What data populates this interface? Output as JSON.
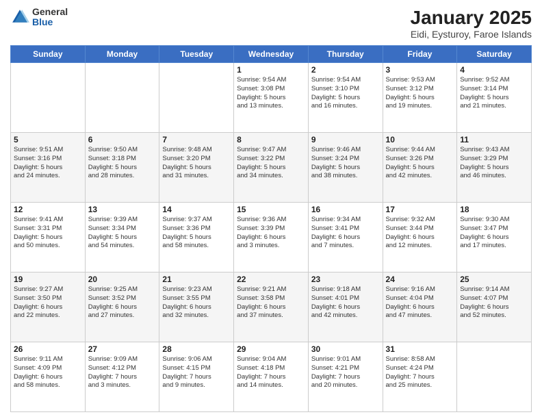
{
  "logo": {
    "general": "General",
    "blue": "Blue"
  },
  "header": {
    "title": "January 2025",
    "subtitle": "Eidi, Eysturoy, Faroe Islands"
  },
  "weekdays": [
    "Sunday",
    "Monday",
    "Tuesday",
    "Wednesday",
    "Thursday",
    "Friday",
    "Saturday"
  ],
  "weeks": [
    [
      {
        "day": "",
        "info": ""
      },
      {
        "day": "",
        "info": ""
      },
      {
        "day": "",
        "info": ""
      },
      {
        "day": "1",
        "info": "Sunrise: 9:54 AM\nSunset: 3:08 PM\nDaylight: 5 hours\nand 13 minutes."
      },
      {
        "day": "2",
        "info": "Sunrise: 9:54 AM\nSunset: 3:10 PM\nDaylight: 5 hours\nand 16 minutes."
      },
      {
        "day": "3",
        "info": "Sunrise: 9:53 AM\nSunset: 3:12 PM\nDaylight: 5 hours\nand 19 minutes."
      },
      {
        "day": "4",
        "info": "Sunrise: 9:52 AM\nSunset: 3:14 PM\nDaylight: 5 hours\nand 21 minutes."
      }
    ],
    [
      {
        "day": "5",
        "info": "Sunrise: 9:51 AM\nSunset: 3:16 PM\nDaylight: 5 hours\nand 24 minutes."
      },
      {
        "day": "6",
        "info": "Sunrise: 9:50 AM\nSunset: 3:18 PM\nDaylight: 5 hours\nand 28 minutes."
      },
      {
        "day": "7",
        "info": "Sunrise: 9:48 AM\nSunset: 3:20 PM\nDaylight: 5 hours\nand 31 minutes."
      },
      {
        "day": "8",
        "info": "Sunrise: 9:47 AM\nSunset: 3:22 PM\nDaylight: 5 hours\nand 34 minutes."
      },
      {
        "day": "9",
        "info": "Sunrise: 9:46 AM\nSunset: 3:24 PM\nDaylight: 5 hours\nand 38 minutes."
      },
      {
        "day": "10",
        "info": "Sunrise: 9:44 AM\nSunset: 3:26 PM\nDaylight: 5 hours\nand 42 minutes."
      },
      {
        "day": "11",
        "info": "Sunrise: 9:43 AM\nSunset: 3:29 PM\nDaylight: 5 hours\nand 46 minutes."
      }
    ],
    [
      {
        "day": "12",
        "info": "Sunrise: 9:41 AM\nSunset: 3:31 PM\nDaylight: 5 hours\nand 50 minutes."
      },
      {
        "day": "13",
        "info": "Sunrise: 9:39 AM\nSunset: 3:34 PM\nDaylight: 5 hours\nand 54 minutes."
      },
      {
        "day": "14",
        "info": "Sunrise: 9:37 AM\nSunset: 3:36 PM\nDaylight: 5 hours\nand 58 minutes."
      },
      {
        "day": "15",
        "info": "Sunrise: 9:36 AM\nSunset: 3:39 PM\nDaylight: 6 hours\nand 3 minutes."
      },
      {
        "day": "16",
        "info": "Sunrise: 9:34 AM\nSunset: 3:41 PM\nDaylight: 6 hours\nand 7 minutes."
      },
      {
        "day": "17",
        "info": "Sunrise: 9:32 AM\nSunset: 3:44 PM\nDaylight: 6 hours\nand 12 minutes."
      },
      {
        "day": "18",
        "info": "Sunrise: 9:30 AM\nSunset: 3:47 PM\nDaylight: 6 hours\nand 17 minutes."
      }
    ],
    [
      {
        "day": "19",
        "info": "Sunrise: 9:27 AM\nSunset: 3:50 PM\nDaylight: 6 hours\nand 22 minutes."
      },
      {
        "day": "20",
        "info": "Sunrise: 9:25 AM\nSunset: 3:52 PM\nDaylight: 6 hours\nand 27 minutes."
      },
      {
        "day": "21",
        "info": "Sunrise: 9:23 AM\nSunset: 3:55 PM\nDaylight: 6 hours\nand 32 minutes."
      },
      {
        "day": "22",
        "info": "Sunrise: 9:21 AM\nSunset: 3:58 PM\nDaylight: 6 hours\nand 37 minutes."
      },
      {
        "day": "23",
        "info": "Sunrise: 9:18 AM\nSunset: 4:01 PM\nDaylight: 6 hours\nand 42 minutes."
      },
      {
        "day": "24",
        "info": "Sunrise: 9:16 AM\nSunset: 4:04 PM\nDaylight: 6 hours\nand 47 minutes."
      },
      {
        "day": "25",
        "info": "Sunrise: 9:14 AM\nSunset: 4:07 PM\nDaylight: 6 hours\nand 52 minutes."
      }
    ],
    [
      {
        "day": "26",
        "info": "Sunrise: 9:11 AM\nSunset: 4:09 PM\nDaylight: 6 hours\nand 58 minutes."
      },
      {
        "day": "27",
        "info": "Sunrise: 9:09 AM\nSunset: 4:12 PM\nDaylight: 7 hours\nand 3 minutes."
      },
      {
        "day": "28",
        "info": "Sunrise: 9:06 AM\nSunset: 4:15 PM\nDaylight: 7 hours\nand 9 minutes."
      },
      {
        "day": "29",
        "info": "Sunrise: 9:04 AM\nSunset: 4:18 PM\nDaylight: 7 hours\nand 14 minutes."
      },
      {
        "day": "30",
        "info": "Sunrise: 9:01 AM\nSunset: 4:21 PM\nDaylight: 7 hours\nand 20 minutes."
      },
      {
        "day": "31",
        "info": "Sunrise: 8:58 AM\nSunset: 4:24 PM\nDaylight: 7 hours\nand 25 minutes."
      },
      {
        "day": "",
        "info": ""
      }
    ]
  ]
}
